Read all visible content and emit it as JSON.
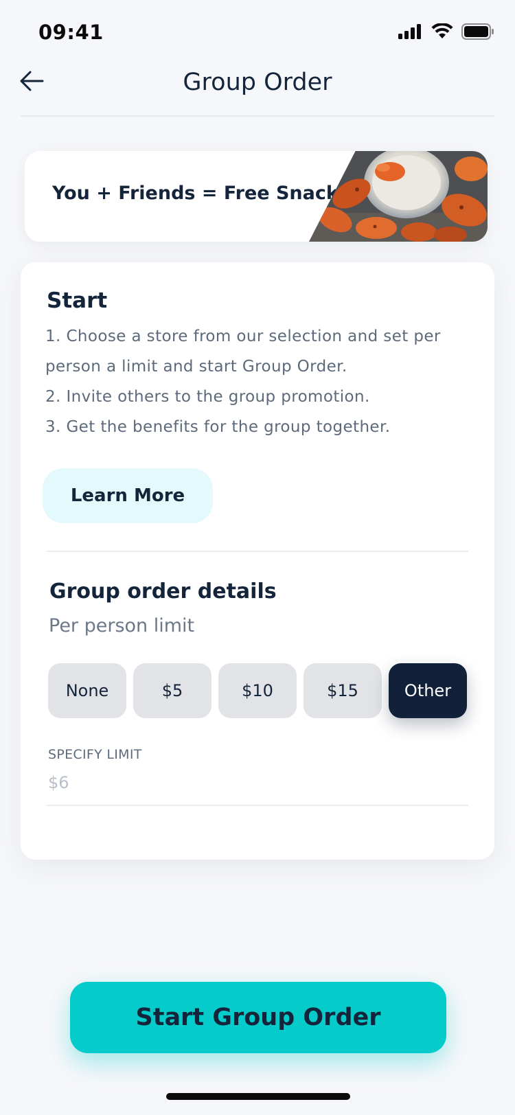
{
  "status_bar": {
    "time": "09:41"
  },
  "nav": {
    "title": "Group Order",
    "back_icon": "arrow-left-icon"
  },
  "promo": {
    "text": "You + Friends = Free Snack",
    "image": "chicken-wings-with-dip-image"
  },
  "start": {
    "title": "Start",
    "steps": [
      "1. Choose a store from our selection and set per person a limit and start Group Order.",
      "2. Invite others to the group promotion.",
      "3. Get the benefits for the group together."
    ],
    "learn_more_label": "Learn More"
  },
  "details": {
    "title": "Group order details",
    "subtitle": "Per person limit",
    "limit_options": [
      "None",
      "$5",
      "$10",
      "$15",
      "Other"
    ],
    "selected_option": "Other",
    "specify_label": "SPECIFY LIMIT",
    "specify_placeholder": "$6"
  },
  "cta": {
    "label": "Start Group Order"
  },
  "colors": {
    "accent": "#05cbcb",
    "dark": "#12213a",
    "background": "#f6f7fa"
  }
}
